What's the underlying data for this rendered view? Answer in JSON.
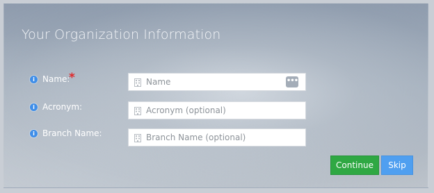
{
  "form": {
    "title": "Your Organization Information",
    "fields": [
      {
        "label": "Name:",
        "required": true,
        "required_mark": "*",
        "placeholder": "Name",
        "value": "",
        "has_more_button": true,
        "more_button_glyph": "•••"
      },
      {
        "label": "Acronym:",
        "required": false,
        "placeholder": "Acronym (optional)",
        "value": ""
      },
      {
        "label": "Branch Name:",
        "required": false,
        "placeholder": "Branch Name (optional)",
        "value": ""
      }
    ],
    "info_glyph": "i"
  },
  "actions": {
    "continue_label": "Continue",
    "skip_label": "Skip"
  },
  "colors": {
    "continue": "#2fa843",
    "skip": "#4f9ff0",
    "info": "#3f8ee8",
    "required": "#e0282a"
  },
  "icons": {
    "info": "info-icon",
    "field": "building-icon",
    "more": "ellipsis-icon"
  }
}
